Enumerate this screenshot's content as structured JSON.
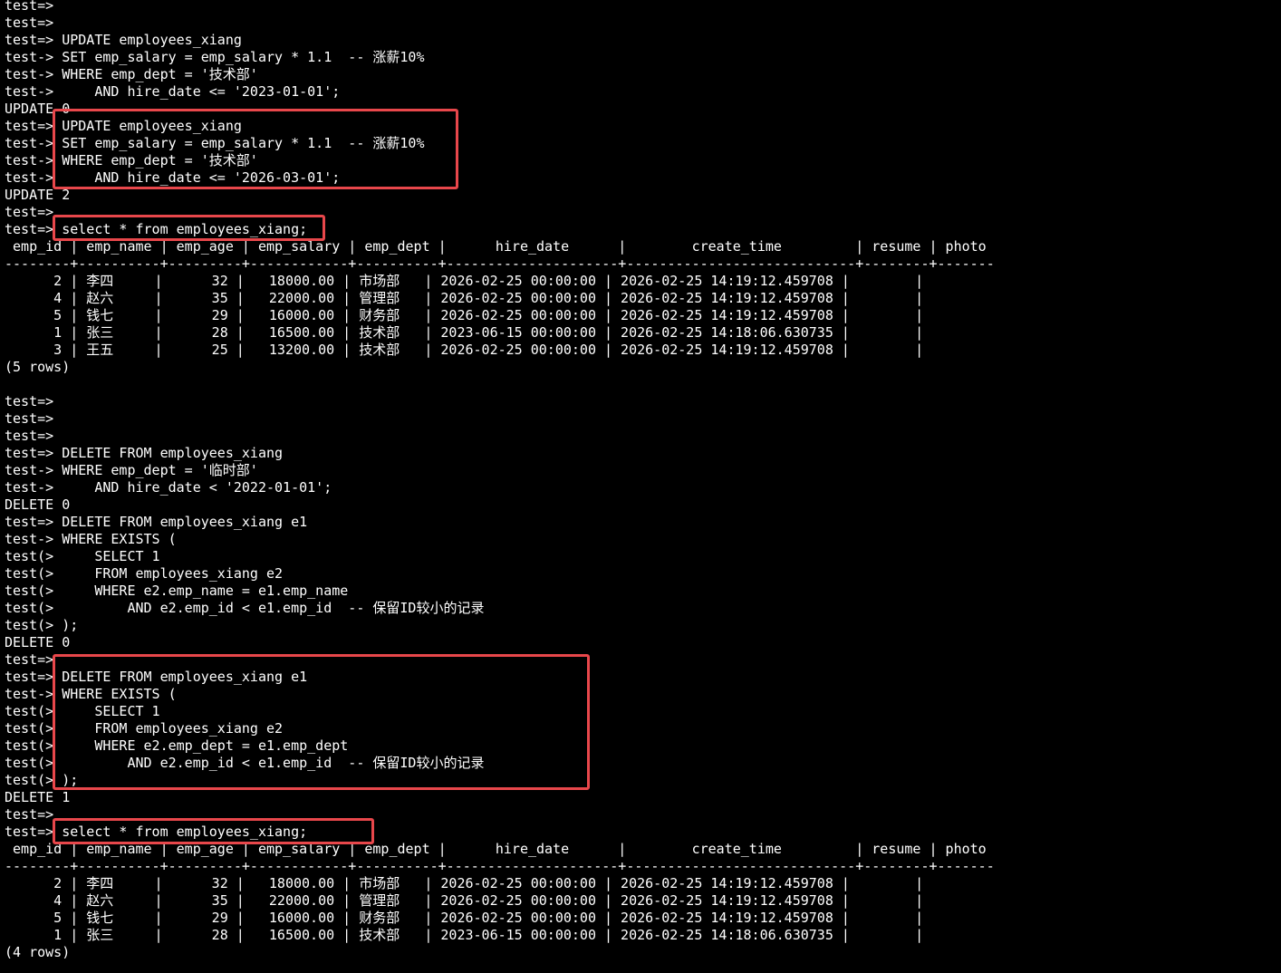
{
  "terminal": {
    "lines": [
      "test=>",
      "test=>",
      "test=> UPDATE employees_xiang",
      "test-> SET emp_salary = emp_salary * 1.1  -- 涨薪10%",
      "test-> WHERE emp_dept = '技术部'",
      "test->     AND hire_date <= '2023-01-01';",
      "UPDATE 0",
      "test=> UPDATE employees_xiang",
      "test-> SET emp_salary = emp_salary * 1.1  -- 涨薪10%",
      "test-> WHERE emp_dept = '技术部'",
      "test->     AND hire_date <= '2026-03-01';",
      "UPDATE 2",
      "test=>",
      "test=> select * from employees_xiang;",
      " emp_id | emp_name | emp_age | emp_salary | emp_dept |      hire_date      |        create_time         | resume | photo",
      "--------+----------+---------+------------+----------+---------------------+----------------------------+--------+-------",
      "      2 | 李四     |      32 |   18000.00 | 市场部   | 2026-02-25 00:00:00 | 2026-02-25 14:19:12.459708 |        |",
      "      4 | 赵六     |      35 |   22000.00 | 管理部   | 2026-02-25 00:00:00 | 2026-02-25 14:19:12.459708 |        |",
      "      5 | 钱七     |      29 |   16000.00 | 财务部   | 2026-02-25 00:00:00 | 2026-02-25 14:19:12.459708 |        |",
      "      1 | 张三     |      28 |   16500.00 | 技术部   | 2023-06-15 00:00:00 | 2026-02-25 14:18:06.630735 |        |",
      "      3 | 王五     |      25 |   13200.00 | 技术部   | 2026-02-25 00:00:00 | 2026-02-25 14:19:12.459708 |        |",
      "(5 rows)",
      "",
      "test=>",
      "test=>",
      "test=>",
      "test=> DELETE FROM employees_xiang",
      "test-> WHERE emp_dept = '临时部'",
      "test->     AND hire_date < '2022-01-01';",
      "DELETE 0",
      "test=> DELETE FROM employees_xiang e1",
      "test-> WHERE EXISTS (",
      "test(>     SELECT 1",
      "test(>     FROM employees_xiang e2",
      "test(>     WHERE e2.emp_name = e1.emp_name",
      "test(>         AND e2.emp_id < e1.emp_id  -- 保留ID较小的记录",
      "test(> );",
      "DELETE 0",
      "test=>",
      "test=> DELETE FROM employees_xiang e1",
      "test-> WHERE EXISTS (",
      "test(>     SELECT 1",
      "test(>     FROM employees_xiang e2",
      "test(>     WHERE e2.emp_dept = e1.emp_dept",
      "test(>         AND e2.emp_id < e1.emp_id  -- 保留ID较小的记录",
      "test(> );",
      "DELETE 1",
      "test=>",
      "test=> select * from employees_xiang;",
      " emp_id | emp_name | emp_age | emp_salary | emp_dept |      hire_date      |        create_time         | resume | photo",
      "--------+----------+---------+------------+----------+---------------------+----------------------------+--------+-------",
      "      2 | 李四     |      32 |   18000.00 | 市场部   | 2026-02-25 00:00:00 | 2026-02-25 14:19:12.459708 |        |",
      "      4 | 赵六     |      35 |   22000.00 | 管理部   | 2026-02-25 00:00:00 | 2026-02-25 14:19:12.459708 |        |",
      "      5 | 钱七     |      29 |   16000.00 | 财务部   | 2026-02-25 00:00:00 | 2026-02-25 14:19:12.459708 |        |",
      "      1 | 张三     |      28 |   16500.00 | 技术部   | 2023-06-15 00:00:00 | 2026-02-25 14:18:06.630735 |        |",
      "(4 rows)"
    ],
    "highlight_color": "#e8474b",
    "background": "#000000",
    "foreground": "#ffffff"
  }
}
